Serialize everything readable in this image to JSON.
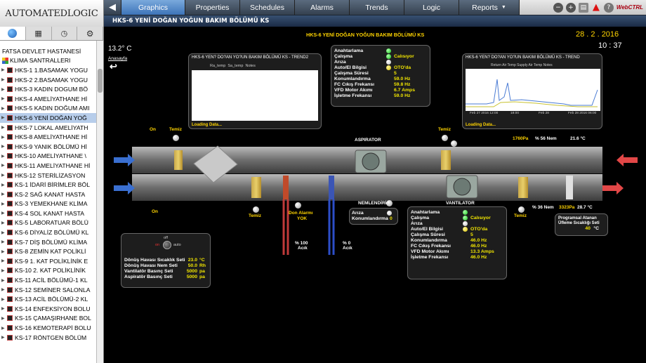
{
  "logo": {
    "text": "AUTOMATEDLOGIC"
  },
  "nav": {
    "back_arrow": "◀",
    "tabs": [
      {
        "label": "Graphics",
        "active": true
      },
      {
        "label": "Properties"
      },
      {
        "label": "Schedules"
      },
      {
        "label": "Alarms"
      },
      {
        "label": "Trends"
      },
      {
        "label": "Logic"
      },
      {
        "label": "Reports"
      }
    ],
    "brand_right": "WebCTRL"
  },
  "titlebar": {
    "text": "HKS-6 YENİ DOĞAN YOĞUN BAKIM BÖLÜMÜ KS"
  },
  "sidebar": {
    "header": "FATSA DEVLET HASTANESİ",
    "root": "KLIMA SANTRALLERI",
    "items": [
      "HKS-1 1.BASAMAK YOGU",
      "HKS-2 2.BASAMAK YOGU",
      "HKS-3 KADIN DOGUM BÖ",
      "HKS-4 AMELİYATHANE Hİ",
      "HKS-5 KADIN DOĞUM AMI",
      "HKS-6 YENİ DOĞAN YOĞ",
      "HKS-7 LOKAL AMELİYATH",
      "HKS-8 AMELİYATHANE Hİ",
      "HKS-9 YANIK BÖLÜMÜ Hİ",
      "HKS-10 AMELİYATHANE \\",
      "HKS-11 AMELİYATHANE Hİ",
      "HKS-12 STERİLİZASYON",
      "KS-1 İDARİ BİRİMLER BÖL",
      "KS-2 SAĞ KANAT HASTA",
      "KS-3 YEMEKHANE KLİMA",
      "KS-4 SOL KANAT HASTA",
      "KS-5 LABORATUAR BÖLÜ",
      "KS-6 DİYALİZ BÖLÜMÜ KL",
      "KS-7 DİŞ BÖLÜMÜ KLİMA",
      "KS-8 ZEMİN KAT POLİKLİ",
      "KS-9 1. KAT POLİKLİNİK E",
      "KS-10 2. KAT POLİKLİNİK",
      "KS-11 ACİL BÖLÜMÜ-1 KL",
      "KS-12 SEMİNER SALONLA",
      "KS-13 ACİL BÖLÜMÜ-2 KL",
      "KS-14 ENFEKSİYON BOLU",
      "KS-15 ÇAMAŞIRHANE BOL",
      "KS-16 KEMOTERAPİ BOLU",
      "KS-17 RÖNTGEN BÖLÜM"
    ],
    "selected_index": 5
  },
  "main": {
    "outdoor_temp": "13.2° C",
    "home_link": "Anasayfa",
    "date": "28 . 2 . 2016",
    "time": "10 : 37",
    "title": "HKS-6 YENİ DOĞAN YOĞUN BAKIM BÖLÜMÜ KS",
    "trend2": {
      "title": "HKS-6 YEN? DO?AN YO?UN BAKIM BÖLÜMÜ KS - TREND2",
      "legend": [
        "Ra_temp",
        "Sa_temp",
        "Notes"
      ],
      "loading": "Loading Data..."
    },
    "trend1": {
      "title": "HKS-6 YEN? DO?AN YO?UN BAKIM BÖLÜMÜ KS - TREND",
      "legend": [
        "Return Air Temp",
        "Supply Air Temp",
        "Notes"
      ],
      "xlabels": [
        "Feb 27 2016\n12:00",
        "18:00",
        "Feb 28",
        "Feb 28 2016\n06:00"
      ],
      "loading": "Loading Data..."
    },
    "aspirator_panel": {
      "rows": [
        {
          "label": "Anahtarlama",
          "value": "",
          "indicator": "green"
        },
        {
          "label": "Çalışma",
          "value": "Calısıyor",
          "indicator": "green"
        },
        {
          "label": "Arıza",
          "value": "",
          "indicator": "white"
        },
        {
          "label": "Auto/El Bilgisi",
          "value": "OTO'da",
          "indicator": "yellow"
        },
        {
          "label": "Çalışma Süresi",
          "value": "5"
        },
        {
          "label": "Konumlandırma",
          "value": "59.0  Hz"
        },
        {
          "label": "FC Cıkış Frekansı",
          "value": "59.8  Hz"
        },
        {
          "label": "VFD Motor Akımı",
          "value": "6.7  Amps"
        },
        {
          "label": "İşletme Frekansı",
          "value": "59.0  Hz"
        }
      ]
    },
    "vantilator_panel": {
      "rows": [
        {
          "label": "Anahtarlama",
          "value": "",
          "indicator": "green"
        },
        {
          "label": "Çalışma",
          "value": "Calısıyor",
          "indicator": "green"
        },
        {
          "label": "Arıza",
          "value": "",
          "indicator": "white"
        },
        {
          "label": "Auto/El Bilgisi",
          "value": "OTO'da",
          "indicator": "yellow"
        },
        {
          "label": "Çalışma Süresi",
          "value": "5"
        },
        {
          "label": "Konumlandırma",
          "value": "46.0  Hz"
        },
        {
          "label": "FC Cıkış Frekansı",
          "value": "46.0  Hz"
        },
        {
          "label": "VFD Motor Akımı",
          "value": "13.3  Amps"
        },
        {
          "label": "İşletme Frekansı",
          "value": "46.0  Hz"
        }
      ]
    },
    "nemlendirici": {
      "title": "NEMLENDİRİCİ",
      "rows": [
        {
          "label": "Arıza",
          "value": ""
        },
        {
          "label": "Konumlandırma",
          "value": "0"
        }
      ]
    },
    "setpoints": {
      "switch_off": "off",
      "switch_on": "on",
      "switch_auto": "auto",
      "rows": [
        {
          "label": "Dönüş Havası Sıcaklık Seti",
          "value": "23.0",
          "unit": "°C"
        },
        {
          "label": "Dönüş Havası Nem Seti",
          "value": "50.0",
          "unit": "Rh"
        },
        {
          "label": "Vantilatör Basınç Seti",
          "value": "5000",
          "unit": "pa"
        },
        {
          "label": "Aspiratör Basınç Seti",
          "value": "5000",
          "unit": "pa"
        }
      ]
    },
    "program_set": {
      "label": "Programsal Atanan Üfleme Sıcaklığı Seti",
      "value": "40",
      "unit": "°C"
    },
    "labels": {
      "aspirator": "ASPIRATOR",
      "vantilator": "VANTILATOR",
      "on_top": "On",
      "on_bottom": "On",
      "temiz1": "Temiz",
      "temiz2": "Temiz",
      "temiz3": "Temiz",
      "temiz4": "Temiz",
      "don_alarm": "Don Alarmı",
      "don_alarm_val": "YOK",
      "valve1": "% 100",
      "valve1b": "Acık",
      "valve2": "% 0",
      "valve2b": "Acık",
      "press_top": "1760Pa",
      "hum_top": "% 56  Nem",
      "temp_top": "21.6  °C",
      "hum_bot": "% 36  Nem",
      "press_bot": "3323Pa",
      "temp_bot": "28.7  °C"
    }
  }
}
